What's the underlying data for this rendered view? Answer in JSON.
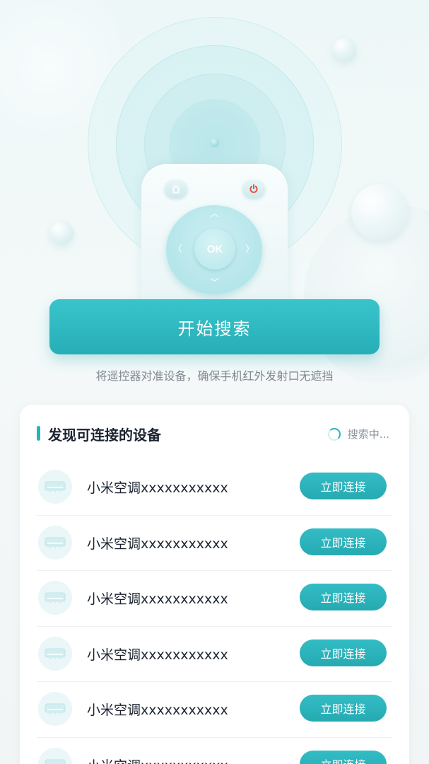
{
  "hero": {
    "ok_label": "OK",
    "home_icon": "home-icon",
    "power_icon": "power-icon",
    "power_color": "#e2453c",
    "accent": "#2ab3bb"
  },
  "start_button": {
    "label": "开始搜索"
  },
  "hint_text": "将遥控器对准设备，确保手机红外发射口无遮挡",
  "devices_panel": {
    "title": "发现可连接的设备",
    "status": "搜索中...",
    "items": [
      {
        "name": "小米空调xxxxxxxxxxx",
        "action": "立即连接",
        "icon": "air-conditioner-icon"
      },
      {
        "name": "小米空调xxxxxxxxxxx",
        "action": "立即连接",
        "icon": "air-conditioner-icon"
      },
      {
        "name": "小米空调xxxxxxxxxxx",
        "action": "立即连接",
        "icon": "air-conditioner-icon"
      },
      {
        "name": "小米空调xxxxxxxxxxx",
        "action": "立即连接",
        "icon": "air-conditioner-icon"
      },
      {
        "name": "小米空调xxxxxxxxxxx",
        "action": "立即连接",
        "icon": "air-conditioner-icon"
      },
      {
        "name": "小米空调xxxxxxxxxxx",
        "action": "立即连接",
        "icon": "air-conditioner-icon"
      }
    ]
  }
}
